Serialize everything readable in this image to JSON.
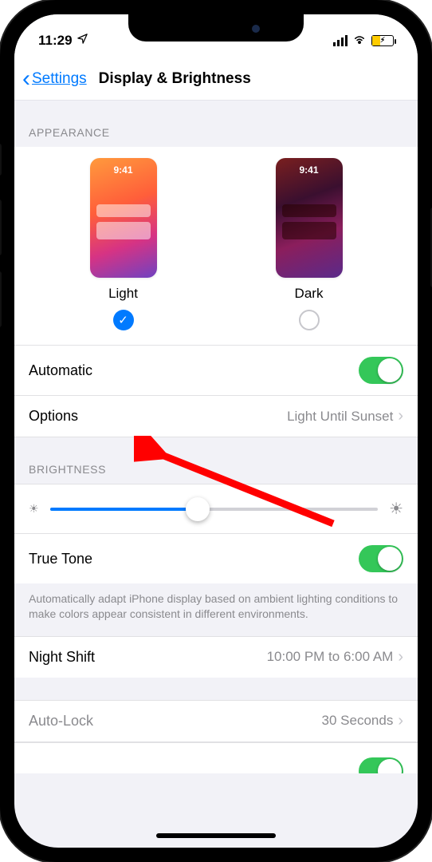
{
  "status": {
    "time": "11:29",
    "location_icon": "location-arrow"
  },
  "nav": {
    "back_label": "Settings",
    "title": "Display & Brightness"
  },
  "appearance": {
    "header": "APPEARANCE",
    "preview_time": "9:41",
    "light_label": "Light",
    "dark_label": "Dark",
    "selected": "light"
  },
  "automatic": {
    "label": "Automatic",
    "enabled": true
  },
  "options": {
    "label": "Options",
    "value": "Light Until Sunset"
  },
  "brightness": {
    "header": "BRIGHTNESS",
    "value_percent": 45
  },
  "trueTone": {
    "label": "True Tone",
    "enabled": true,
    "footer": "Automatically adapt iPhone display based on ambient lighting conditions to make colors appear consistent in different environments."
  },
  "nightShift": {
    "label": "Night Shift",
    "value": "10:00 PM to 6:00 AM"
  },
  "autoLock": {
    "label": "Auto-Lock",
    "value": "30 Seconds"
  }
}
